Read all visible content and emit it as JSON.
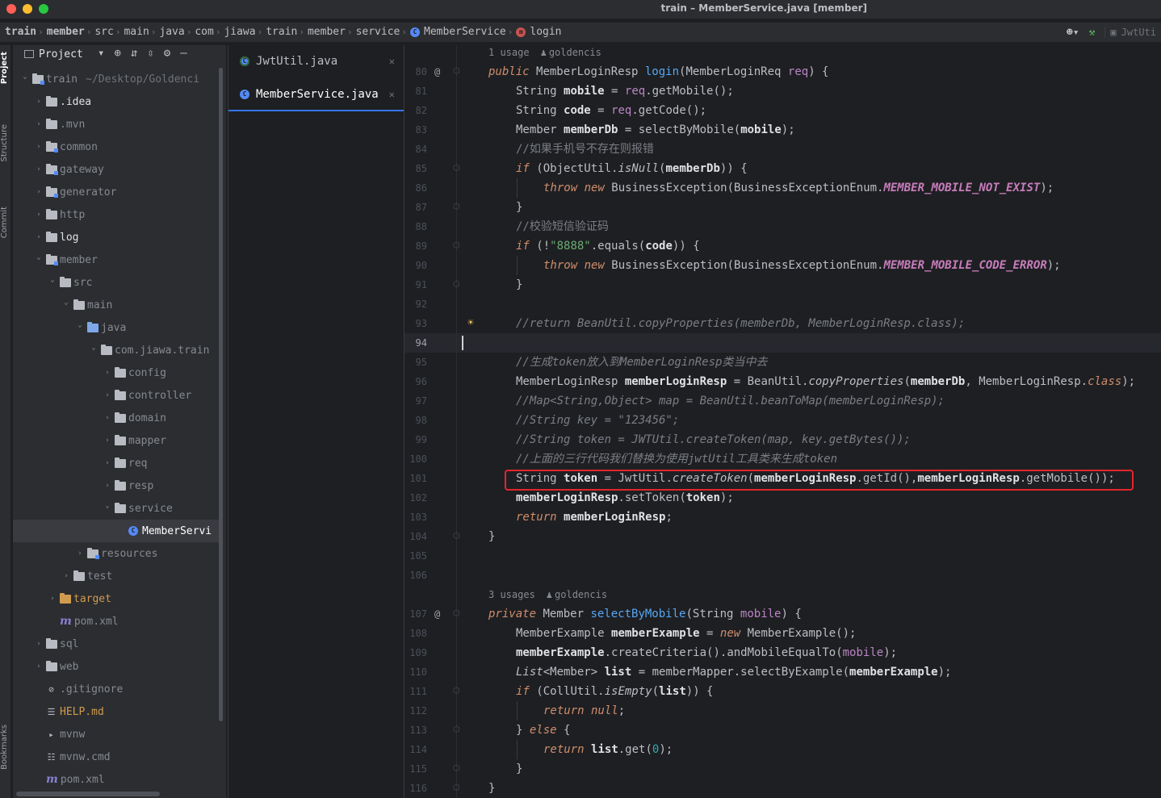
{
  "window": {
    "title": "train – MemberService.java [member]"
  },
  "breadcrumb": [
    {
      "label": "train",
      "bold": true
    },
    {
      "label": "member",
      "bold": true
    },
    {
      "label": "src"
    },
    {
      "label": "main"
    },
    {
      "label": "java"
    },
    {
      "label": "com"
    },
    {
      "label": "jiawa"
    },
    {
      "label": "train"
    },
    {
      "label": "member"
    },
    {
      "label": "service"
    },
    {
      "label": "MemberService",
      "icon": "class-icon"
    },
    {
      "label": "login",
      "icon": "method-icon"
    }
  ],
  "toolbar": {
    "run_config": "JwtUti",
    "user_icon": "user-icon",
    "build_icon": "hammer-icon"
  },
  "tool_strip": {
    "project": "Project",
    "structure": "Structure",
    "commit": "Commit",
    "bookmarks": "Bookmarks"
  },
  "project_panel": {
    "title": "Project"
  },
  "tree": [
    {
      "label": "train",
      "path": "~/Desktop/Goldenci",
      "indent": 0,
      "chev": "down",
      "icon": "module-folder"
    },
    {
      "label": ".idea",
      "indent": 1,
      "chev": "right",
      "icon": "folder",
      "bright": true
    },
    {
      "label": ".mvn",
      "indent": 1,
      "chev": "right",
      "icon": "folder"
    },
    {
      "label": "common",
      "indent": 1,
      "chev": "right",
      "icon": "module-folder"
    },
    {
      "label": "gateway",
      "indent": 1,
      "chev": "right",
      "icon": "module-folder"
    },
    {
      "label": "generator",
      "indent": 1,
      "chev": "right",
      "icon": "module-folder"
    },
    {
      "label": "http",
      "indent": 1,
      "chev": "right",
      "icon": "folder"
    },
    {
      "label": "log",
      "indent": 1,
      "chev": "right",
      "icon": "folder",
      "bright": true
    },
    {
      "label": "member",
      "indent": 1,
      "chev": "down",
      "icon": "module-folder"
    },
    {
      "label": "src",
      "indent": 2,
      "chev": "down",
      "icon": "folder"
    },
    {
      "label": "main",
      "indent": 3,
      "chev": "down",
      "icon": "folder"
    },
    {
      "label": "java",
      "indent": 4,
      "chev": "down",
      "icon": "source-folder"
    },
    {
      "label": "com.jiawa.train",
      "indent": 5,
      "chev": "down",
      "icon": "package"
    },
    {
      "label": "config",
      "indent": 6,
      "chev": "right",
      "icon": "package"
    },
    {
      "label": "controller",
      "indent": 6,
      "chev": "right",
      "icon": "package"
    },
    {
      "label": "domain",
      "indent": 6,
      "chev": "right",
      "icon": "package"
    },
    {
      "label": "mapper",
      "indent": 6,
      "chev": "right",
      "icon": "package"
    },
    {
      "label": "req",
      "indent": 6,
      "chev": "right",
      "icon": "package"
    },
    {
      "label": "resp",
      "indent": 6,
      "chev": "right",
      "icon": "package"
    },
    {
      "label": "service",
      "indent": 6,
      "chev": "down",
      "icon": "package"
    },
    {
      "label": "MemberServi",
      "indent": 7,
      "chev": "none",
      "icon": "class",
      "selected": true
    },
    {
      "label": "resources",
      "indent": 4,
      "chev": "right",
      "icon": "resources-folder"
    },
    {
      "label": "test",
      "indent": 3,
      "chev": "right",
      "icon": "folder"
    },
    {
      "label": "target",
      "indent": 2,
      "chev": "right",
      "icon": "excluded-folder",
      "orange": true
    },
    {
      "label": "pom.xml",
      "indent": 2,
      "chev": "none",
      "icon": "maven"
    },
    {
      "label": "sql",
      "indent": 1,
      "chev": "right",
      "icon": "folder"
    },
    {
      "label": "web",
      "indent": 1,
      "chev": "right",
      "icon": "folder"
    },
    {
      "label": ".gitignore",
      "indent": 1,
      "chev": "none",
      "icon": "ignore-file"
    },
    {
      "label": "HELP.md",
      "indent": 1,
      "chev": "none",
      "icon": "markdown",
      "orange": true
    },
    {
      "label": "mvnw",
      "indent": 1,
      "chev": "none",
      "icon": "script"
    },
    {
      "label": "mvnw.cmd",
      "indent": 1,
      "chev": "none",
      "icon": "file"
    },
    {
      "label": "pom.xml",
      "indent": 1,
      "chev": "none",
      "icon": "maven"
    }
  ],
  "tabs": [
    {
      "label": "JwtUtil.java",
      "active": false
    },
    {
      "label": "MemberService.java",
      "active": true
    }
  ],
  "editor": {
    "current_line": 94,
    "lines": [
      {
        "inlay": "1 usage",
        "author": "goldencis"
      },
      {
        "n": 80,
        "marker": "@",
        "fold": true,
        "tokens": [
          [
            "kwi",
            "public "
          ],
          [
            "ty",
            "MemberLoginResp "
          ],
          [
            "fn",
            "login"
          ],
          [
            "ty",
            "("
          ],
          [
            "ty",
            "MemberLoginReq "
          ],
          [
            "par",
            "req"
          ],
          [
            "ty",
            ") {"
          ]
        ]
      },
      {
        "n": 81,
        "indent": 1,
        "tokens": [
          [
            "ty",
            "String "
          ],
          [
            "var",
            "mobile"
          ],
          [
            "ty",
            " = "
          ],
          [
            "par",
            "req"
          ],
          [
            "ty",
            "."
          ],
          [
            "mcall",
            "getMobile"
          ],
          [
            "ty",
            "();"
          ]
        ]
      },
      {
        "n": 82,
        "indent": 1,
        "tokens": [
          [
            "ty",
            "String "
          ],
          [
            "var",
            "code"
          ],
          [
            "ty",
            " = "
          ],
          [
            "par",
            "req"
          ],
          [
            "ty",
            "."
          ],
          [
            "mcall",
            "getCode"
          ],
          [
            "ty",
            "();"
          ]
        ]
      },
      {
        "n": 83,
        "indent": 1,
        "tokens": [
          [
            "ty",
            "Member "
          ],
          [
            "var",
            "memberDb"
          ],
          [
            "ty",
            " = "
          ],
          [
            "mcall",
            "selectByMobile"
          ],
          [
            "ty",
            "("
          ],
          [
            "var",
            "mobile"
          ],
          [
            "ty",
            ");"
          ]
        ]
      },
      {
        "n": 84,
        "indent": 1,
        "tokens": [
          [
            "cmc",
            "//如果手机号不存在则报错"
          ]
        ]
      },
      {
        "n": 85,
        "indent": 1,
        "fold": true,
        "tokens": [
          [
            "kwi",
            "if "
          ],
          [
            "ty",
            "(ObjectUtil."
          ],
          [
            "static",
            "isNull"
          ],
          [
            "ty",
            "("
          ],
          [
            "var",
            "memberDb"
          ],
          [
            "ty",
            ")) {"
          ]
        ]
      },
      {
        "n": 86,
        "indent": 2,
        "guide": true,
        "tokens": [
          [
            "kwi",
            "throw new "
          ],
          [
            "ty",
            "BusinessException(BusinessExceptionEnum."
          ],
          [
            "const",
            "MEMBER_MOBILE_NOT_EXIST"
          ],
          [
            "ty",
            ");"
          ]
        ]
      },
      {
        "n": 87,
        "indent": 1,
        "fold": true,
        "tokens": [
          [
            "ty",
            "}"
          ]
        ]
      },
      {
        "n": 88,
        "indent": 1,
        "tokens": [
          [
            "cmc",
            "//校验短信验证码"
          ]
        ]
      },
      {
        "n": 89,
        "indent": 1,
        "fold": true,
        "tokens": [
          [
            "kwi",
            "if "
          ],
          [
            "ty",
            "(!"
          ],
          [
            "str",
            "\"8888\""
          ],
          [
            "ty",
            "."
          ],
          [
            "mcall",
            "equals"
          ],
          [
            "ty",
            "("
          ],
          [
            "var",
            "code"
          ],
          [
            "ty",
            ")) {"
          ]
        ]
      },
      {
        "n": 90,
        "indent": 2,
        "guide": true,
        "tokens": [
          [
            "kwi",
            "throw new "
          ],
          [
            "ty",
            "BusinessException(BusinessExceptionEnum."
          ],
          [
            "const",
            "MEMBER_MOBILE_CODE_ERROR"
          ],
          [
            "ty",
            ");"
          ]
        ]
      },
      {
        "n": 91,
        "indent": 1,
        "fold": true,
        "tokens": [
          [
            "ty",
            "}"
          ]
        ]
      },
      {
        "n": 92,
        "tokens": []
      },
      {
        "n": 93,
        "indent": 1,
        "bulb": true,
        "tokens": [
          [
            "cm",
            "//return BeanUtil.copyProperties(memberDb, MemberLoginResp.class);"
          ]
        ]
      },
      {
        "n": 94,
        "caret": true,
        "tokens": []
      },
      {
        "n": 95,
        "indent": 1,
        "tokens": [
          [
            "cm",
            "//生成token放入到MemberLoginResp类当中去"
          ]
        ]
      },
      {
        "n": 96,
        "indent": 1,
        "tokens": [
          [
            "ty",
            "MemberLoginResp "
          ],
          [
            "var",
            "memberLoginResp"
          ],
          [
            "ty",
            " = BeanUtil."
          ],
          [
            "static",
            "copyProperties"
          ],
          [
            "ty",
            "("
          ],
          [
            "var",
            "memberDb"
          ],
          [
            "ty",
            ", MemberLoginResp."
          ],
          [
            "kwi",
            "class"
          ],
          [
            "ty",
            ");"
          ]
        ]
      },
      {
        "n": 97,
        "indent": 1,
        "tokens": [
          [
            "cm",
            "//Map<String,Object> map = BeanUtil.beanToMap(memberLoginResp);"
          ]
        ]
      },
      {
        "n": 98,
        "indent": 1,
        "tokens": [
          [
            "cm",
            "//String key = \"123456\";"
          ]
        ]
      },
      {
        "n": 99,
        "indent": 1,
        "tokens": [
          [
            "cm",
            "//String token = JWTUtil.createToken(map, key.getBytes());"
          ]
        ]
      },
      {
        "n": 100,
        "indent": 1,
        "tokens": [
          [
            "cm",
            "//上面的三行代码我们替换为使用jwtUtil工具类来生成token"
          ]
        ]
      },
      {
        "n": 101,
        "indent": 1,
        "tokens": [
          [
            "ty",
            "String "
          ],
          [
            "var",
            "token"
          ],
          [
            "ty",
            " = JwtUtil."
          ],
          [
            "static",
            "createToken"
          ],
          [
            "ty",
            "("
          ],
          [
            "var",
            "memberLoginResp"
          ],
          [
            "ty",
            "."
          ],
          [
            "mcall",
            "getId"
          ],
          [
            "ty",
            "(),"
          ],
          [
            "var",
            "memberLoginResp"
          ],
          [
            "ty",
            "."
          ],
          [
            "mcall",
            "getMobile"
          ],
          [
            "ty",
            "());"
          ]
        ]
      },
      {
        "n": 102,
        "indent": 1,
        "tokens": [
          [
            "var",
            "memberLoginResp"
          ],
          [
            "ty",
            "."
          ],
          [
            "mcall",
            "setToken"
          ],
          [
            "ty",
            "("
          ],
          [
            "var",
            "token"
          ],
          [
            "ty",
            ");"
          ]
        ]
      },
      {
        "n": 103,
        "indent": 1,
        "tokens": [
          [
            "kwi",
            "return "
          ],
          [
            "var",
            "memberLoginResp"
          ],
          [
            "ty",
            ";"
          ]
        ]
      },
      {
        "n": 104,
        "fold": true,
        "tokens": [
          [
            "ty",
            "}"
          ]
        ]
      },
      {
        "n": 105,
        "tokens": []
      },
      {
        "n": 106,
        "tokens": []
      },
      {
        "inlay": "3 usages",
        "author": "goldencis"
      },
      {
        "n": 107,
        "marker": "@",
        "fold": true,
        "tokens": [
          [
            "kwi",
            "private "
          ],
          [
            "ty",
            "Member "
          ],
          [
            "fn",
            "selectByMobile"
          ],
          [
            "ty",
            "(String "
          ],
          [
            "par",
            "mobile"
          ],
          [
            "ty",
            ") {"
          ]
        ]
      },
      {
        "n": 108,
        "indent": 1,
        "tokens": [
          [
            "ty",
            "MemberExample "
          ],
          [
            "var",
            "memberExample"
          ],
          [
            "ty",
            " = "
          ],
          [
            "kwi",
            "new "
          ],
          [
            "ty",
            "MemberExample();"
          ]
        ]
      },
      {
        "n": 109,
        "indent": 1,
        "tokens": [
          [
            "var",
            "memberExample"
          ],
          [
            "ty",
            "."
          ],
          [
            "mcall",
            "createCriteria"
          ],
          [
            "ty",
            "()."
          ],
          [
            "mcall",
            "andMobileEqualTo"
          ],
          [
            "ty",
            "("
          ],
          [
            "par",
            "mobile"
          ],
          [
            "ty",
            ");"
          ]
        ]
      },
      {
        "n": 110,
        "indent": 1,
        "tokens": [
          [
            "static",
            "List"
          ],
          [
            "ty",
            "<Member> "
          ],
          [
            "var",
            "list"
          ],
          [
            "ty",
            " = memberMapper."
          ],
          [
            "mcall",
            "selectByExample"
          ],
          [
            "ty",
            "("
          ],
          [
            "var",
            "memberExample"
          ],
          [
            "ty",
            ");"
          ]
        ]
      },
      {
        "n": 111,
        "indent": 1,
        "fold": true,
        "tokens": [
          [
            "kwi",
            "if "
          ],
          [
            "ty",
            "(CollUtil."
          ],
          [
            "static",
            "isEmpty"
          ],
          [
            "ty",
            "("
          ],
          [
            "var",
            "list"
          ],
          [
            "ty",
            ")) {"
          ]
        ]
      },
      {
        "n": 112,
        "indent": 2,
        "guide": true,
        "tokens": [
          [
            "kwi",
            "return null"
          ],
          [
            "ty",
            ";"
          ]
        ]
      },
      {
        "n": 113,
        "indent": 1,
        "fold": true,
        "tokens": [
          [
            "ty",
            "} "
          ],
          [
            "kwi",
            "else "
          ],
          [
            "ty",
            "{"
          ]
        ]
      },
      {
        "n": 114,
        "indent": 2,
        "guide": true,
        "tokens": [
          [
            "kwi",
            "return "
          ],
          [
            "var",
            "list"
          ],
          [
            "ty",
            "."
          ],
          [
            "mcall",
            "get"
          ],
          [
            "ty",
            "("
          ],
          [
            "num",
            "0"
          ],
          [
            "ty",
            ");"
          ]
        ]
      },
      {
        "n": 115,
        "indent": 1,
        "fold": true,
        "tokens": [
          [
            "ty",
            "}"
          ]
        ]
      },
      {
        "n": 116,
        "fold": true,
        "tokens": [
          [
            "ty",
            "}"
          ]
        ]
      }
    ]
  }
}
